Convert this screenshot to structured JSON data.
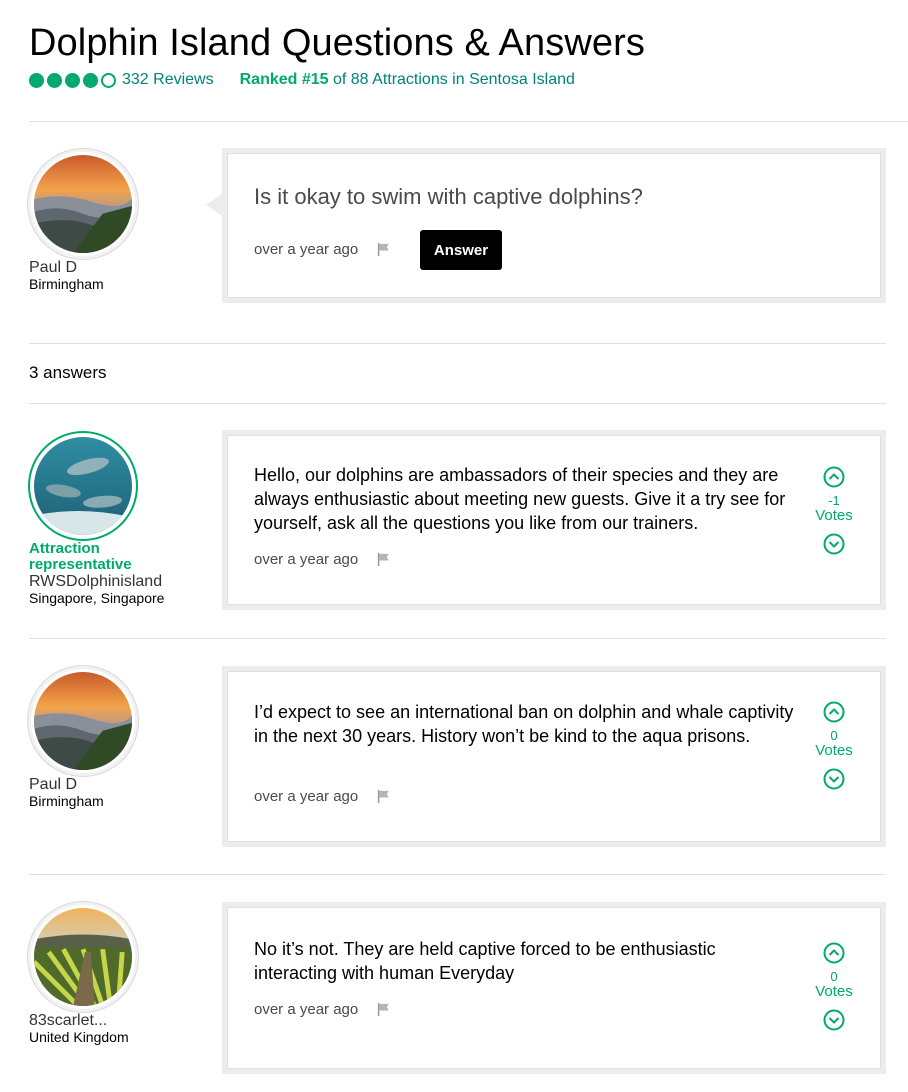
{
  "header": {
    "title": "Dolphin Island Questions & Answers",
    "rating_bubbles": [
      1,
      1,
      1,
      1,
      0
    ],
    "reviews_label": "332 Reviews",
    "rank_prefix": "Ranked #15",
    "rank_suffix": " of 88 Attractions in Sentosa Island"
  },
  "question": {
    "text": "Is it okay to swim with captive dolphins?",
    "user": {
      "name": "Paul D",
      "location": "Birmingham"
    },
    "time": "over a year ago",
    "answer_button": "Answer"
  },
  "answers_count": "3 answers",
  "answers": [
    {
      "rep_label": "Attraction representative",
      "user": {
        "name": "RWSDolphinisland",
        "location": "Singapore, Singapore"
      },
      "text": "Hello, our dolphins are ambassadors of their species and they are always enthusiastic about meeting new guests. Give it a try see for yourself, ask all the questions you like from our trainers.",
      "time": "over a year ago",
      "votes": "-1",
      "votes_label": "Votes"
    },
    {
      "user": {
        "name": "Paul D",
        "location": "Birmingham"
      },
      "text": "I’d expect to see an international ban on dolphin and whale captivity in the next 30 years. History won’t be kind to the aqua prisons.",
      "time": "over a year ago",
      "votes": "0",
      "votes_label": "Votes"
    },
    {
      "user": {
        "name": "83scarlet...",
        "location": "United Kingdom"
      },
      "text": "No it’s not. They are held captive forced to be enthusiastic interacting with human Everyday",
      "time": "over a year ago",
      "votes": "0",
      "votes_label": "Votes"
    }
  ],
  "colors": {
    "accent": "#00aa6c",
    "link": "#00827a"
  }
}
